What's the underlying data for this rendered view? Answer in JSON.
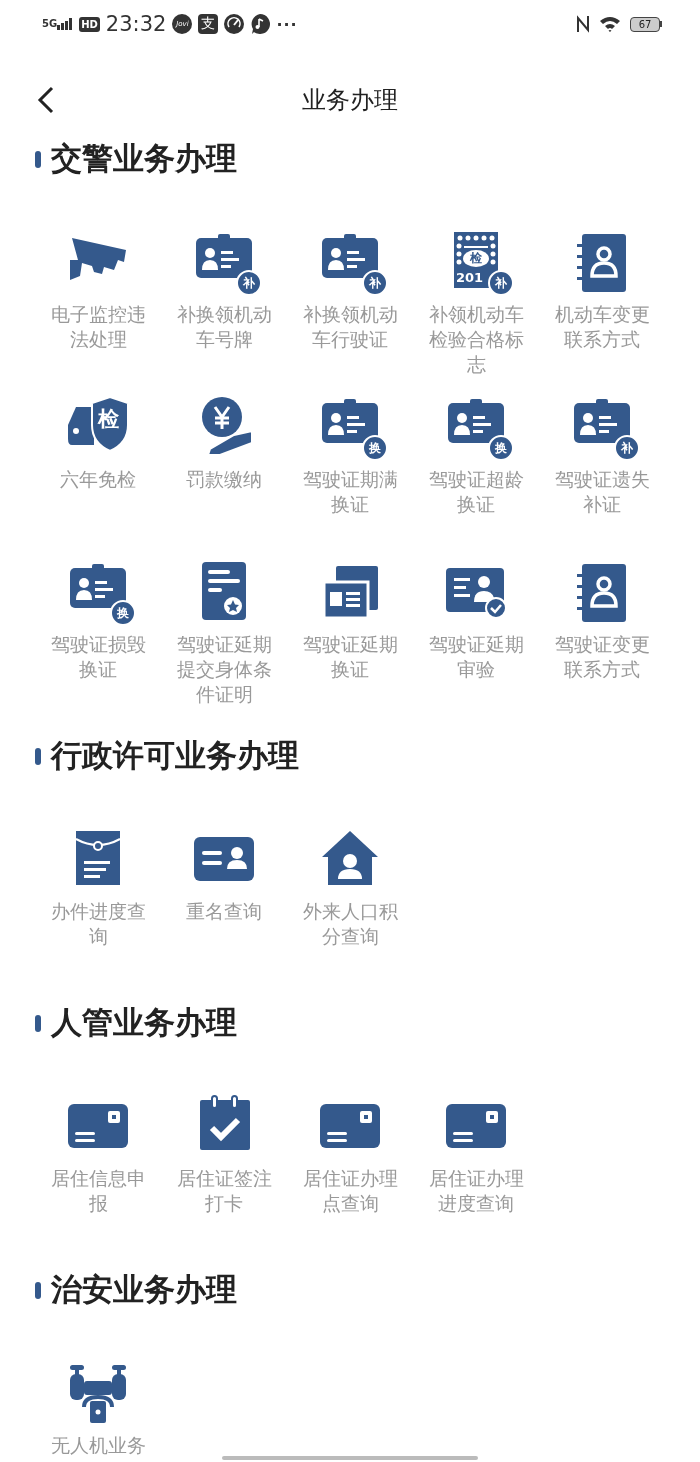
{
  "status_bar": {
    "network": "5G",
    "hd": "HD",
    "time": "23:32",
    "jovi": "Jovi",
    "pay": "支",
    "more": "···",
    "battery": "67"
  },
  "nav": {
    "title": "业务办理"
  },
  "sections": [
    {
      "title": "交警业务办理",
      "items": [
        {
          "kind": "camera",
          "label": "电子监控违法处理"
        },
        {
          "kind": "id-badge",
          "badge": "补",
          "label": "补换领机动车号牌"
        },
        {
          "kind": "id-badge",
          "badge": "补",
          "label": "补换领机动车行驶证"
        },
        {
          "kind": "sticker",
          "mark": "检",
          "year": "201",
          "badge": "补",
          "label": "补领机动车检验合格标志"
        },
        {
          "kind": "contact-book",
          "label": "机动车变更联系方式"
        },
        {
          "kind": "car-shield",
          "mark": "检",
          "label": "六年免检"
        },
        {
          "kind": "yen-hand",
          "label": "罚款缴纳"
        },
        {
          "kind": "id-badge",
          "badge": "换",
          "label": "驾驶证期满换证"
        },
        {
          "kind": "id-badge",
          "badge": "换",
          "label": "驾驶证超龄换证"
        },
        {
          "kind": "id-badge",
          "badge": "补",
          "label": "驾驶证遗失补证"
        },
        {
          "kind": "id-badge",
          "badge": "换",
          "label": "驾驶证损毁换证"
        },
        {
          "kind": "document-star",
          "label": "驾驶证延期提交身体条件证明"
        },
        {
          "kind": "id-cards",
          "label": "驾驶证延期换证"
        },
        {
          "kind": "id-check",
          "label": "驾驶证延期审验"
        },
        {
          "kind": "contact-book",
          "label": "驾驶证变更联系方式"
        }
      ]
    },
    {
      "title": "行政许可业务办理",
      "items": [
        {
          "kind": "envelope-doc",
          "label": "办件进度查询"
        },
        {
          "kind": "name-card",
          "label": "重名查询"
        },
        {
          "kind": "house-person",
          "label": "外来人口积分查询"
        }
      ]
    },
    {
      "title": "人管业务办理",
      "items": [
        {
          "kind": "card-chip",
          "label": "居住信息申报"
        },
        {
          "kind": "calendar-check",
          "label": "居住证签注打卡"
        },
        {
          "kind": "card-chip",
          "label": "居住证办理点查询"
        },
        {
          "kind": "card-chip",
          "label": "居住证办理进度查询"
        }
      ]
    },
    {
      "title": "治安业务办理",
      "items": [
        {
          "kind": "drone",
          "label": "无人机业务"
        }
      ]
    }
  ]
}
